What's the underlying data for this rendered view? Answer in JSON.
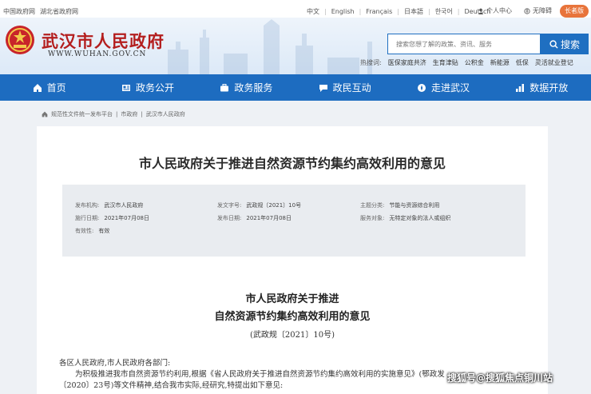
{
  "topbar": {
    "links": [
      "中国政府网",
      "湖北省政府网"
    ],
    "languages": [
      "中文",
      "English",
      "Français",
      "日本語",
      "한국어",
      "Deutsch"
    ],
    "user_center": "个人中心",
    "accessibility": "无障碍",
    "elder_mode": "长者版"
  },
  "header": {
    "site_title": "武汉市人民政府",
    "site_url": "WWW.WUHAN.GOV.CN",
    "search_placeholder": "搜索您想了解的政策、资讯、服务",
    "search_button": "搜索",
    "hot_label": "热搜词:",
    "hot_words": [
      "医保家庭共济",
      "生育津贴",
      "公积金",
      "新能源",
      "低保",
      "灵活就业登记"
    ]
  },
  "nav": [
    {
      "label": "首页",
      "icon": "home-icon"
    },
    {
      "label": "政务公开",
      "icon": "news-icon"
    },
    {
      "label": "政务服务",
      "icon": "briefcase-icon"
    },
    {
      "label": "政民互动",
      "icon": "chat-icon"
    },
    {
      "label": "走进武汉",
      "icon": "compass-icon"
    },
    {
      "label": "数据开放",
      "icon": "chart-icon"
    }
  ],
  "breadcrumb": [
    "规范性文件统一发布平台",
    "市政府",
    "武汉市人民政府"
  ],
  "article": {
    "heading": "市人民政府关于推进自然资源节约集约高效利用的意见",
    "meta": {
      "issuer_label": "发布机构:",
      "issuer": "武汉市人民政府",
      "doc_no_label": "发文字号:",
      "doc_no": "武政规〔2021〕10号",
      "topic_label": "主题分类:",
      "topic": "节能与资源综合利用",
      "effective_label": "施行日期:",
      "effective": "2021年07月08日",
      "publish_label": "发布日期:",
      "publish": "2021年07月08日",
      "audience_label": "服务对象:",
      "audience": "无特定对象的法人或组织",
      "validity_label": "有效性:",
      "validity": "有效"
    },
    "doc_title_line1": "市人民政府关于推进",
    "doc_title_line2": "自然资源节约集约高效利用的意见",
    "doc_number": "(武政规〔2021〕10号)",
    "salutation": "各区人民政府,市人民政府各部门:",
    "para1": "为积极推进我市自然资源节约利用,根据《省人民政府关于推进自然资源节约集约高效利用的实施意见》(鄂政发",
    "para2": "〔2020〕23号)等文件精神,结合我市实际,经研究,特提出如下意见:"
  },
  "watermark": "搜狐号@搜狐焦点铜川站",
  "colors": {
    "brand_blue": "#1d6cc0",
    "title_red": "#b41e1e",
    "elder_orange": "#e8743b"
  }
}
